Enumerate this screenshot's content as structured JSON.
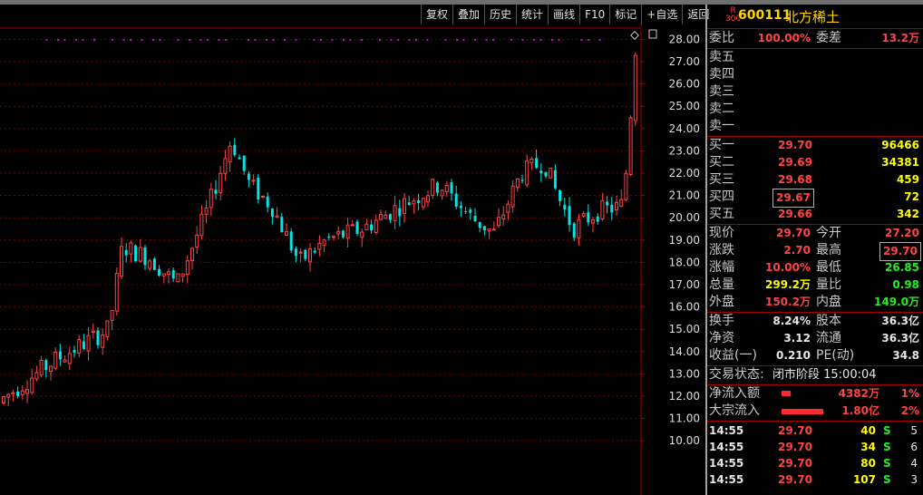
{
  "toolbar": {
    "items": [
      "复权",
      "叠加",
      "历史",
      "统计",
      "画线",
      "F10",
      "标记",
      "+自选",
      "返回"
    ]
  },
  "chart": {
    "price_ticks": [
      "28.00",
      "27.00",
      "26.00",
      "25.00",
      "24.00",
      "23.00",
      "22.00",
      "21.00",
      "20.00",
      "19.00",
      "18.00",
      "17.00",
      "16.00",
      "15.00",
      "14.00",
      "13.00",
      "12.00",
      "11.00",
      "10.00"
    ],
    "last_price_marker": "29.70",
    "up_color": "#ff4444",
    "down_color": "#00e6e6"
  },
  "quote": {
    "index_badge_top": "R",
    "index_badge_bottom": "300",
    "code": "600111",
    "name": "北方稀土",
    "weibi_label": "委比",
    "weibi_value": "100.00%",
    "weicha_label": "委差",
    "weicha_value": "13.2万",
    "sells": [
      {
        "label": "卖五",
        "price": "",
        "vol": ""
      },
      {
        "label": "卖四",
        "price": "",
        "vol": ""
      },
      {
        "label": "卖三",
        "price": "",
        "vol": ""
      },
      {
        "label": "卖二",
        "price": "",
        "vol": ""
      },
      {
        "label": "卖一",
        "price": "",
        "vol": ""
      }
    ],
    "buys": [
      {
        "label": "买一",
        "price": "29.70",
        "vol": "96466"
      },
      {
        "label": "买二",
        "price": "29.69",
        "vol": "34381"
      },
      {
        "label": "买三",
        "price": "29.68",
        "vol": "459"
      },
      {
        "label": "买四",
        "price": "29.67",
        "vol": "72"
      },
      {
        "label": "买五",
        "price": "29.66",
        "vol": "342"
      }
    ],
    "stats": [
      {
        "l1": "现价",
        "v1": "29.70",
        "c1": "red",
        "l2": "今开",
        "v2": "27.20",
        "c2": "red"
      },
      {
        "l1": "涨跌",
        "v1": "2.70",
        "c1": "red",
        "l2": "最高",
        "v2": "29.70",
        "c2": "red"
      },
      {
        "l1": "涨幅",
        "v1": "10.00%",
        "c1": "red",
        "l2": "最低",
        "v2": "26.85",
        "c2": "green"
      },
      {
        "l1": "总量",
        "v1": "299.2万",
        "c1": "yellow",
        "l2": "量比",
        "v2": "0.98",
        "c2": "green"
      },
      {
        "l1": "外盘",
        "v1": "150.2万",
        "c1": "red",
        "l2": "内盘",
        "v2": "149.0万",
        "c2": "green"
      }
    ],
    "fund": [
      {
        "l1": "换手",
        "v1": "8.24%",
        "l2": "股本",
        "v2": "36.3亿"
      },
      {
        "l1": "净资",
        "v1": "3.12",
        "l2": "流通",
        "v2": "36.3亿"
      },
      {
        "l1": "收益(一)",
        "v1": "0.210",
        "l2": "PE(动)",
        "v2": "34.8"
      }
    ],
    "trade_status_label": "交易状态:",
    "trade_status_value": "闭市阶段 15:00:04",
    "flows": [
      {
        "label": "净流入额",
        "value": "4382万",
        "pct": "1%"
      },
      {
        "label": "大宗流入",
        "value": "1.80亿",
        "pct": "2%"
      }
    ],
    "ticks": [
      {
        "time": "14:55",
        "price": "29.70",
        "vol": "40",
        "side": "S",
        "num": "5"
      },
      {
        "time": "14:55",
        "price": "29.70",
        "vol": "34",
        "side": "S",
        "num": "6"
      },
      {
        "time": "14:55",
        "price": "29.70",
        "vol": "80",
        "side": "S",
        "num": "4"
      },
      {
        "time": "14:55",
        "price": "29.70",
        "vol": "107",
        "side": "S",
        "num": "3"
      }
    ]
  }
}
